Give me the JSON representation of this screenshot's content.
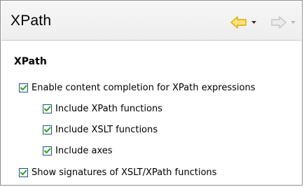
{
  "header": {
    "title": "XPath",
    "back_icon": "back-arrow-icon",
    "forward_icon": "forward-arrow-icon",
    "menu_icon": "chevron-down-icon"
  },
  "section": {
    "title": "XPath"
  },
  "options": [
    {
      "label": "Enable content completion for XPath expressions",
      "checked": true
    },
    {
      "label": "Include XPath functions",
      "checked": true
    },
    {
      "label": "Include XSLT functions",
      "checked": true
    },
    {
      "label": "Include axes",
      "checked": true
    },
    {
      "label": "Show signatures of XSLT/XPath functions",
      "checked": true
    }
  ],
  "colors": {
    "back_arrow": "#f2c200",
    "forward_arrow": "#c9c9c9",
    "check": "#2aa21a",
    "checkbox_border": "#1c5180"
  }
}
